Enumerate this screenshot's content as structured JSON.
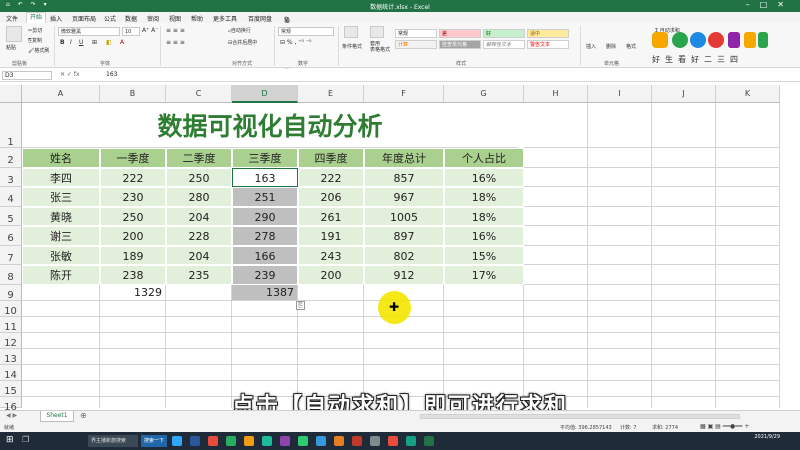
{
  "window": {
    "title": "数据统计.xlsx - Excel",
    "quick_access": "⌂ ↶ ↷ ▾"
  },
  "tabs": [
    "文件",
    "开始",
    "插入",
    "页面布局",
    "公式",
    "数据",
    "审阅",
    "视图",
    "帮助",
    "更多工具",
    "百度网盘",
    "操作说明搜索"
  ],
  "ribbon": {
    "paste": "粘贴",
    "cut": "剪切",
    "copy": "复制",
    "format_painter": "格式刷",
    "font_name": "微软雅黑",
    "font_size": "10",
    "wrap_text": "自动换行",
    "merge_center": "合并后居中",
    "number_format": "常规",
    "conditional_format": "条件格式",
    "format_as_table": "套用\n表格格式",
    "insert": "插入",
    "delete": "删除",
    "format": "格式",
    "autosum": "自动求和",
    "groups": [
      "剪贴板",
      "字体",
      "对齐方式",
      "数字",
      "样式",
      "单元格"
    ],
    "styles": [
      {
        "label": "常规",
        "bg": "#ffffff",
        "color": "#222222"
      },
      {
        "label": "差",
        "bg": "#ffc7ce",
        "color": "#9c0006"
      },
      {
        "label": "好",
        "bg": "#c6efce",
        "color": "#006100"
      },
      {
        "label": "适中",
        "bg": "#ffeb9c",
        "color": "#9c5700"
      },
      {
        "label": "计算",
        "bg": "#f2f2f2",
        "color": "#fa7d00"
      },
      {
        "label": "检查单元格",
        "bg": "#a5a5a5",
        "color": "#ffffff"
      },
      {
        "label": "解释性文本",
        "bg": "#ffffff",
        "color": "#7f7f7f"
      },
      {
        "label": "警告文本",
        "bg": "#ffffff",
        "color": "#ff0000"
      }
    ]
  },
  "logo": {
    "chars": [
      "好",
      "生",
      "看",
      "好",
      "二",
      "三",
      "四"
    ],
    "accent": "#2aa34a"
  },
  "formula_bar": {
    "name_box": "D3",
    "fx": "fx",
    "value": "163"
  },
  "columns": [
    "A",
    "B",
    "C",
    "D",
    "E",
    "F",
    "G",
    "H",
    "I",
    "J",
    "K"
  ],
  "rows": [
    "1",
    "2",
    "3",
    "4",
    "5",
    "6",
    "7",
    "8",
    "9",
    "10",
    "11",
    "12",
    "13",
    "14",
    "15",
    "16"
  ],
  "sheet": {
    "title": "数据可视化自动分析",
    "headers": [
      "姓名",
      "一季度",
      "二季度",
      "三季度",
      "四季度",
      "年度总计",
      "个人占比"
    ],
    "data": [
      [
        "李四",
        "222",
        "250",
        "163",
        "222",
        "857",
        "16%"
      ],
      [
        "张三",
        "230",
        "280",
        "251",
        "206",
        "967",
        "18%"
      ],
      [
        "黄晓",
        "250",
        "204",
        "290",
        "261",
        "1005",
        "18%"
      ],
      [
        "谢三",
        "200",
        "228",
        "278",
        "191",
        "897",
        "16%"
      ],
      [
        "张敏",
        "189",
        "204",
        "166",
        "243",
        "802",
        "15%"
      ],
      [
        "陈开",
        "238",
        "235",
        "239",
        "200",
        "912",
        "17%"
      ]
    ],
    "totals": {
      "B": "1329",
      "D": "1387"
    },
    "header_bg": "#a9d08e",
    "data_bg": "#e2efda",
    "selected_bg": "#bfbfbf"
  },
  "subtitle": "点击【自动求和】即可进行求和",
  "sheet_tab": "Sheet1",
  "status": {
    "ready": "就绪",
    "average": "平均值: 396.2857143",
    "count": "计数: 7",
    "sum": "求和: 2774"
  },
  "taskbar": {
    "search1": "界主播新旅搜索",
    "search2": "搜索一下",
    "date": "2021/9/29"
  }
}
